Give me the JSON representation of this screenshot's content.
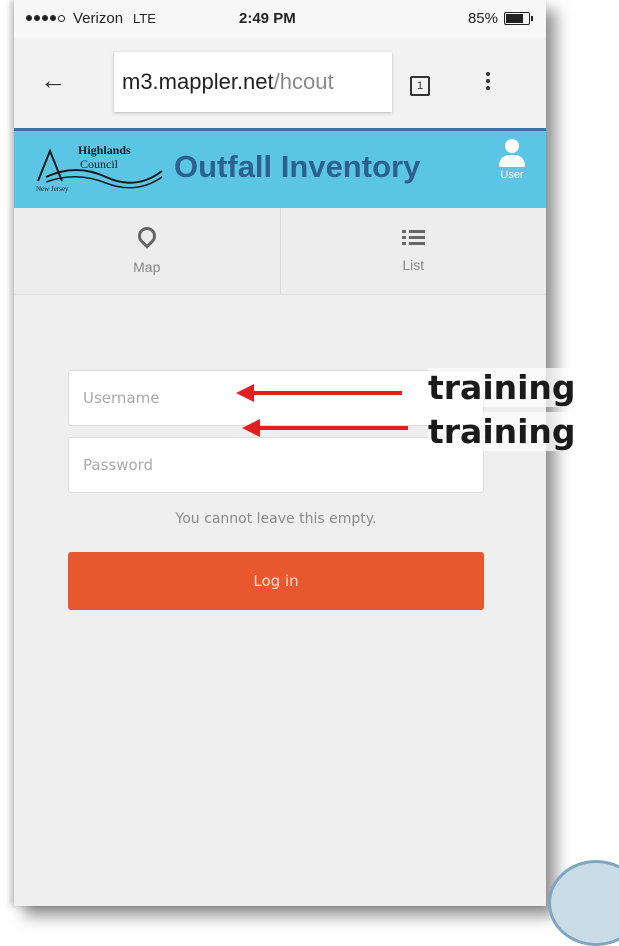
{
  "status_bar": {
    "carrier": "Verizon",
    "network": "LTE",
    "time": "2:49 PM",
    "battery": "85%",
    "battery_level": 0.85
  },
  "browser": {
    "url_domain": "m3.mappler.net",
    "url_path": "/hcout",
    "tab_count": "1"
  },
  "app": {
    "logo_line1": "Highlands",
    "logo_line2": "Council",
    "logo_line3": "New Jersey",
    "title": "Outfall Inventory",
    "user_label": "User"
  },
  "nav": {
    "map_label": "Map",
    "list_label": "List"
  },
  "form": {
    "username_placeholder": "Username",
    "password_placeholder": "Password",
    "error_text": "You cannot leave this empty.",
    "login_label": "Log in"
  },
  "annotations": {
    "username_note": "training",
    "password_note": "training"
  },
  "colors": {
    "header_bg": "#5bc5e6",
    "title": "#2d5f93",
    "login_button": "#e8572e",
    "arrow": "#e02020"
  }
}
